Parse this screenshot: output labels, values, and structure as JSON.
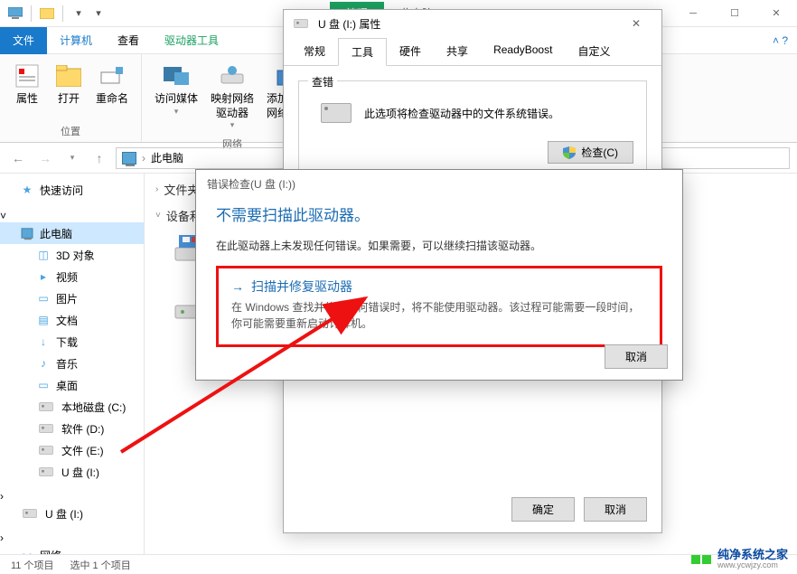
{
  "explorer": {
    "ctx_tab_group": "管理",
    "ctx_tab_title": "此电脑",
    "tabs": {
      "file": "文件",
      "computer": "计算机",
      "view": "查看",
      "drive_tools": "驱动器工具"
    },
    "ribbon": {
      "location_group": "位置",
      "network_group": "网络",
      "properties": "属性",
      "open": "打开",
      "rename": "重命名",
      "access_media": "访问媒体",
      "map_drive": "映射网络\n驱动器",
      "add_location": "添加一个\n网络位置"
    },
    "breadcrumb": "此电脑",
    "sidebar": {
      "quick": "快速访问",
      "this_pc": "此电脑",
      "items": [
        "3D 对象",
        "视频",
        "图片",
        "文档",
        "下载",
        "音乐",
        "桌面",
        "本地磁盘 (C:)",
        "软件 (D:)",
        "文件 (E:)",
        "U 盘 (I:)"
      ],
      "removable": "U 盘 (I:)",
      "network": "网络"
    },
    "content": {
      "folders_header": "文件夹",
      "devices_header": "设备和驱动器"
    },
    "status": {
      "count": "11 个项目",
      "selected": "选中 1 个项目"
    }
  },
  "props": {
    "title": "U 盘 (I:) 属性",
    "tabs": [
      "常规",
      "工具",
      "硬件",
      "共享",
      "ReadyBoost",
      "自定义"
    ],
    "active_tab": 1,
    "check_group": "查错",
    "check_desc": "此选项将检查驱动器中的文件系统错误。",
    "check_btn": "检查(C)",
    "ok": "确定",
    "cancel": "取消"
  },
  "err": {
    "title": "错误检查(U 盘 (I:))",
    "heading": "不需要扫描此驱动器。",
    "text": "在此驱动器上未发现任何错误。如果需要，可以继续扫描该驱动器。",
    "scan_title": "扫描并修复驱动器",
    "scan_desc": "在 Windows 查找并修复任何错误时，将不能使用驱动器。该过程可能需要一段时间，你可能需要重新启动计算机。",
    "cancel": "取消"
  },
  "watermark": "纯净系统之家",
  "watermark_url": "www.ycwjzy.com"
}
